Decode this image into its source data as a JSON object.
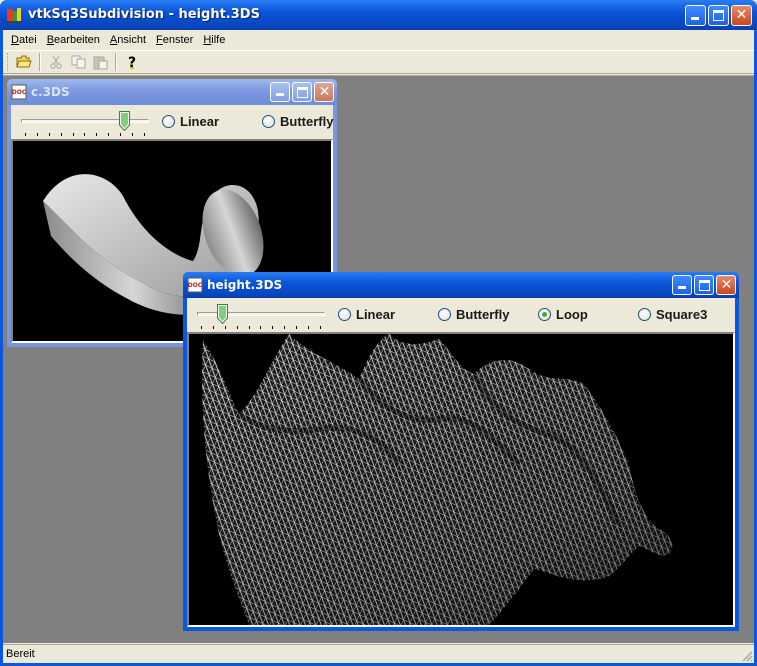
{
  "app": {
    "title": "vtkSq3Subdivision - height.3DS",
    "icon": "vtk-app-icon"
  },
  "menu": {
    "items": [
      {
        "label": "Datei",
        "accel": "D",
        "rest": "atei"
      },
      {
        "label": "Bearbeiten",
        "accel": "B",
        "rest": "earbeiten"
      },
      {
        "label": "Ansicht",
        "accel": "A",
        "rest": "nsicht"
      },
      {
        "label": "Fenster",
        "accel": "F",
        "rest": "enster"
      },
      {
        "label": "Hilfe",
        "accel": "H",
        "rest": "ilfe"
      }
    ]
  },
  "toolbar": {
    "buttons": [
      "open-folder-icon",
      "cut-icon",
      "copy-icon",
      "paste-icon",
      "help-icon"
    ]
  },
  "status": {
    "text": "Bereit"
  },
  "child_c": {
    "title": "c.3DS",
    "slider_value": 0.8,
    "options": [
      "Linear",
      "Butterfly"
    ]
  },
  "child_height": {
    "title": "height.3DS",
    "slider_value": 0.2,
    "options": [
      "Linear",
      "Butterfly",
      "Loop",
      "Square3"
    ],
    "selected": "Loop"
  },
  "colors": {
    "title_active": "#0a55d8",
    "title_inactive": "#7a96df",
    "mdi_background": "#808080",
    "radio_selected": "#3dae3d"
  }
}
